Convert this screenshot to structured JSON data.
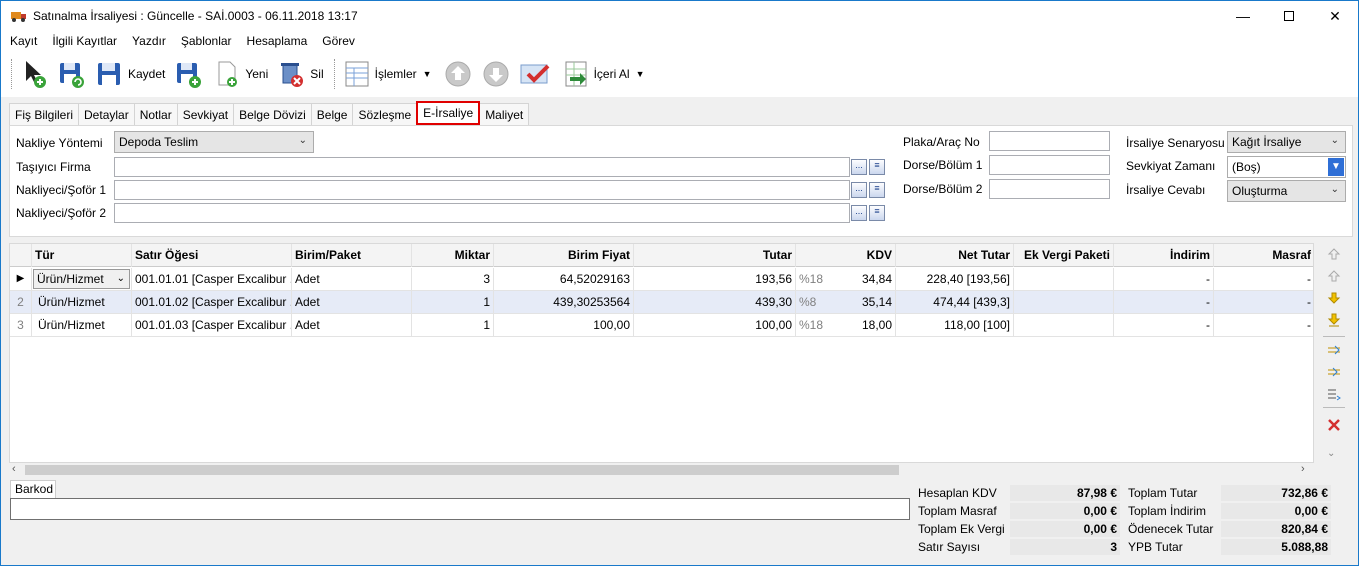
{
  "window": {
    "title": "Satınalma İrsaliyesi : Güncelle - SAİ.0003 - 06.11.2018 13:17"
  },
  "menu": [
    "Kayıt",
    "İlgili Kayıtlar",
    "Yazdır",
    "Şablonlar",
    "Hesaplama",
    "Görev"
  ],
  "toolbar": {
    "save": "Kaydet",
    "new": "Yeni",
    "delete": "Sil",
    "operations": "İşlemler",
    "import": "İçeri Al"
  },
  "tabs": [
    "Fiş Bilgileri",
    "Detaylar",
    "Notlar",
    "Sevkiyat",
    "Belge Dövizi",
    "Belge",
    "Sözleşme",
    "E-İrsaliye",
    "Maliyet"
  ],
  "form": {
    "nakliye_yontemi_label": "Nakliye Yöntemi",
    "nakliye_yontemi_value": "Depoda Teslim",
    "tasiyici_label": "Taşıyıcı Firma",
    "nakliyeci1_label": "Nakliyeci/Şoför 1",
    "nakliyeci2_label": "Nakliyeci/Şoför 2",
    "plaka_label": "Plaka/Araç No",
    "dorse1_label": "Dorse/Bölüm 1",
    "dorse2_label": "Dorse/Bölüm 2",
    "senaryo_label": "İrsaliye Senaryosu",
    "senaryo_value": "Kağıt İrsaliye",
    "sevkiyat_label": "Sevkiyat Zamanı",
    "sevkiyat_value": "(Boş)",
    "cevap_label": "İrsaliye Cevabı",
    "cevap_value": "Oluşturma"
  },
  "grid": {
    "columns": [
      "Tür",
      "Satır Öğesi",
      "Birim/Paket",
      "Miktar",
      "Birim Fiyat",
      "Tutar",
      "KDV",
      "Net Tutar",
      "Ek Vergi Paketi",
      "İndirim",
      "Masraf"
    ],
    "rows": [
      {
        "num": "",
        "tur": "Ürün/Hizmet",
        "oge": "001.01.01 [Casper Excalibur ...",
        "birim": "Adet",
        "miktar": "3",
        "fiyat": "64,52029163",
        "tutar": "193,56",
        "kdvp": "%18",
        "kdv": "34,84",
        "net": "228,40 [193,56]",
        "indirim": "-",
        "masraf": "-"
      },
      {
        "num": "2",
        "tur": "Ürün/Hizmet",
        "oge": "001.01.02 [Casper Excalibur ...",
        "birim": "Adet",
        "miktar": "1",
        "fiyat": "439,30253564",
        "tutar": "439,30",
        "kdvp": "%8",
        "kdv": "35,14",
        "net": "474,44 [439,3]",
        "indirim": "-",
        "masraf": "-"
      },
      {
        "num": "3",
        "tur": "Ürün/Hizmet",
        "oge": "001.01.03 [Casper Excalibur ...",
        "birim": "Adet",
        "miktar": "1",
        "fiyat": "100,00",
        "tutar": "100,00",
        "kdvp": "%18",
        "kdv": "18,00",
        "net": "118,00 [100]",
        "indirim": "-",
        "masraf": "-"
      }
    ]
  },
  "barkod": {
    "label": "Barkod"
  },
  "summary": {
    "hesaplan_kdv_label": "Hesaplan KDV",
    "hesaplan_kdv": "87,98 €",
    "toplam_masraf_label": "Toplam Masraf",
    "toplam_masraf": "0,00 €",
    "toplam_ek_vergi_label": "Toplam Ek Vergi",
    "toplam_ek_vergi": "0,00 €",
    "satir_sayisi_label": "Satır Sayısı",
    "satir_sayisi": "3",
    "toplam_tutar_label": "Toplam Tutar",
    "toplam_tutar": "732,86 €",
    "toplam_indirim_label": "Toplam İndirim",
    "toplam_indirim": "0,00 €",
    "odenecek_tutar_label": "Ödenecek Tutar",
    "odenecek_tutar": "820,84 €",
    "ypb_tutar_label": "YPB Tutar",
    "ypb_tutar": "5.088,88"
  }
}
